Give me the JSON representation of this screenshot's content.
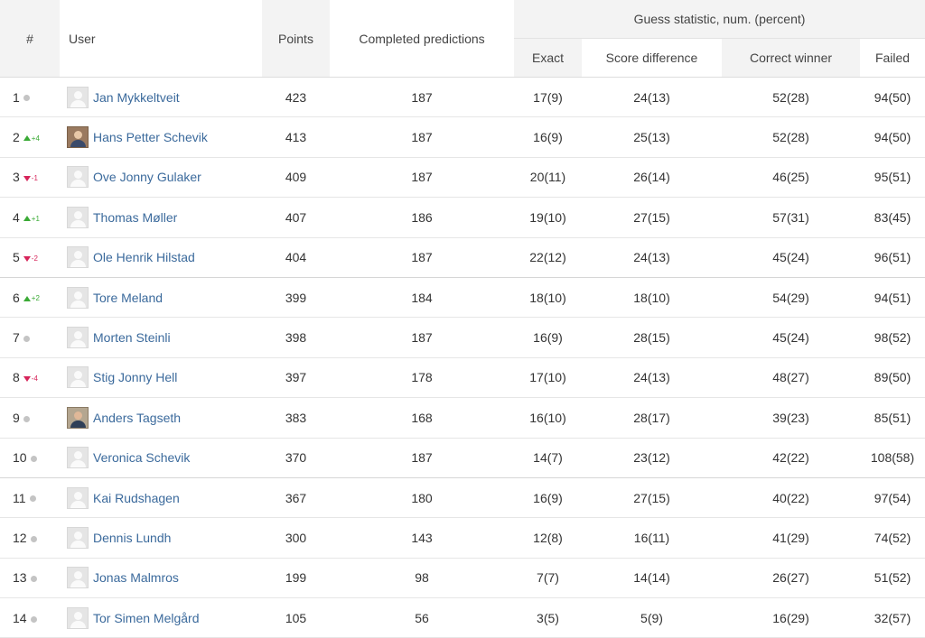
{
  "headers": {
    "rank": "#",
    "user": "User",
    "points": "Points",
    "completed": "Completed predictions",
    "group": "Guess statistic, num. (percent)",
    "exact": "Exact",
    "score_diff": "Score difference",
    "correct_winner": "Correct winner",
    "failed": "Failed"
  },
  "colors": {
    "up": "#3aaa35",
    "down": "#d6245a",
    "same": "#c4c4c4",
    "link": "#3b6a9c"
  },
  "rows": [
    {
      "rank": "1",
      "trend": "same",
      "change": "",
      "user": "Jan Mykkeltveit",
      "avatar": "placeholder",
      "points": "423",
      "completed": "187",
      "exact": "17(9)",
      "score_diff": "24(13)",
      "correct_winner": "52(28)",
      "failed": "94(50)"
    },
    {
      "rank": "2",
      "trend": "up",
      "change": "+4",
      "user": "Hans Petter Schevik",
      "avatar": "photo",
      "points": "413",
      "completed": "187",
      "exact": "16(9)",
      "score_diff": "25(13)",
      "correct_winner": "52(28)",
      "failed": "94(50)"
    },
    {
      "rank": "3",
      "trend": "down",
      "change": "-1",
      "user": "Ove Jonny Gulaker",
      "avatar": "placeholder",
      "points": "409",
      "completed": "187",
      "exact": "20(11)",
      "score_diff": "26(14)",
      "correct_winner": "46(25)",
      "failed": "95(51)"
    },
    {
      "rank": "4",
      "trend": "up",
      "change": "+1",
      "user": "Thomas Møller",
      "avatar": "placeholder",
      "points": "407",
      "completed": "186",
      "exact": "19(10)",
      "score_diff": "27(15)",
      "correct_winner": "57(31)",
      "failed": "83(45)"
    },
    {
      "rank": "5",
      "trend": "down",
      "change": "-2",
      "user": "Ole Henrik Hilstad",
      "avatar": "placeholder",
      "points": "404",
      "completed": "187",
      "exact": "22(12)",
      "score_diff": "24(13)",
      "correct_winner": "45(24)",
      "failed": "96(51)"
    },
    {
      "rank": "6",
      "trend": "up",
      "change": "+2",
      "user": "Tore Meland",
      "avatar": "placeholder",
      "points": "399",
      "completed": "184",
      "exact": "18(10)",
      "score_diff": "18(10)",
      "correct_winner": "54(29)",
      "failed": "94(51)"
    },
    {
      "rank": "7",
      "trend": "same",
      "change": "",
      "user": "Morten Steinli",
      "avatar": "placeholder",
      "points": "398",
      "completed": "187",
      "exact": "16(9)",
      "score_diff": "28(15)",
      "correct_winner": "45(24)",
      "failed": "98(52)"
    },
    {
      "rank": "8",
      "trend": "down",
      "change": "-4",
      "user": "Stig Jonny Hell",
      "avatar": "placeholder",
      "points": "397",
      "completed": "178",
      "exact": "17(10)",
      "score_diff": "24(13)",
      "correct_winner": "48(27)",
      "failed": "89(50)"
    },
    {
      "rank": "9",
      "trend": "same",
      "change": "",
      "user": "Anders Tagseth",
      "avatar": "photo2",
      "points": "383",
      "completed": "168",
      "exact": "16(10)",
      "score_diff": "28(17)",
      "correct_winner": "39(23)",
      "failed": "85(51)"
    },
    {
      "rank": "10",
      "trend": "same",
      "change": "",
      "user": "Veronica Schevik",
      "avatar": "placeholder",
      "points": "370",
      "completed": "187",
      "exact": "14(7)",
      "score_diff": "23(12)",
      "correct_winner": "42(22)",
      "failed": "108(58)"
    },
    {
      "rank": "11",
      "trend": "same",
      "change": "",
      "user": "Kai Rudshagen",
      "avatar": "placeholder",
      "points": "367",
      "completed": "180",
      "exact": "16(9)",
      "score_diff": "27(15)",
      "correct_winner": "40(22)",
      "failed": "97(54)"
    },
    {
      "rank": "12",
      "trend": "same",
      "change": "",
      "user": "Dennis Lundh",
      "avatar": "placeholder",
      "points": "300",
      "completed": "143",
      "exact": "12(8)",
      "score_diff": "16(11)",
      "correct_winner": "41(29)",
      "failed": "74(52)"
    },
    {
      "rank": "13",
      "trend": "same",
      "change": "",
      "user": "Jonas Malmros",
      "avatar": "placeholder",
      "points": "199",
      "completed": "98",
      "exact": "7(7)",
      "score_diff": "14(14)",
      "correct_winner": "26(27)",
      "failed": "51(52)"
    },
    {
      "rank": "14",
      "trend": "same",
      "change": "",
      "user": "Tor Simen Melgård",
      "avatar": "placeholder",
      "points": "105",
      "completed": "56",
      "exact": "3(5)",
      "score_diff": "5(9)",
      "correct_winner": "16(29)",
      "failed": "32(57)"
    }
  ]
}
